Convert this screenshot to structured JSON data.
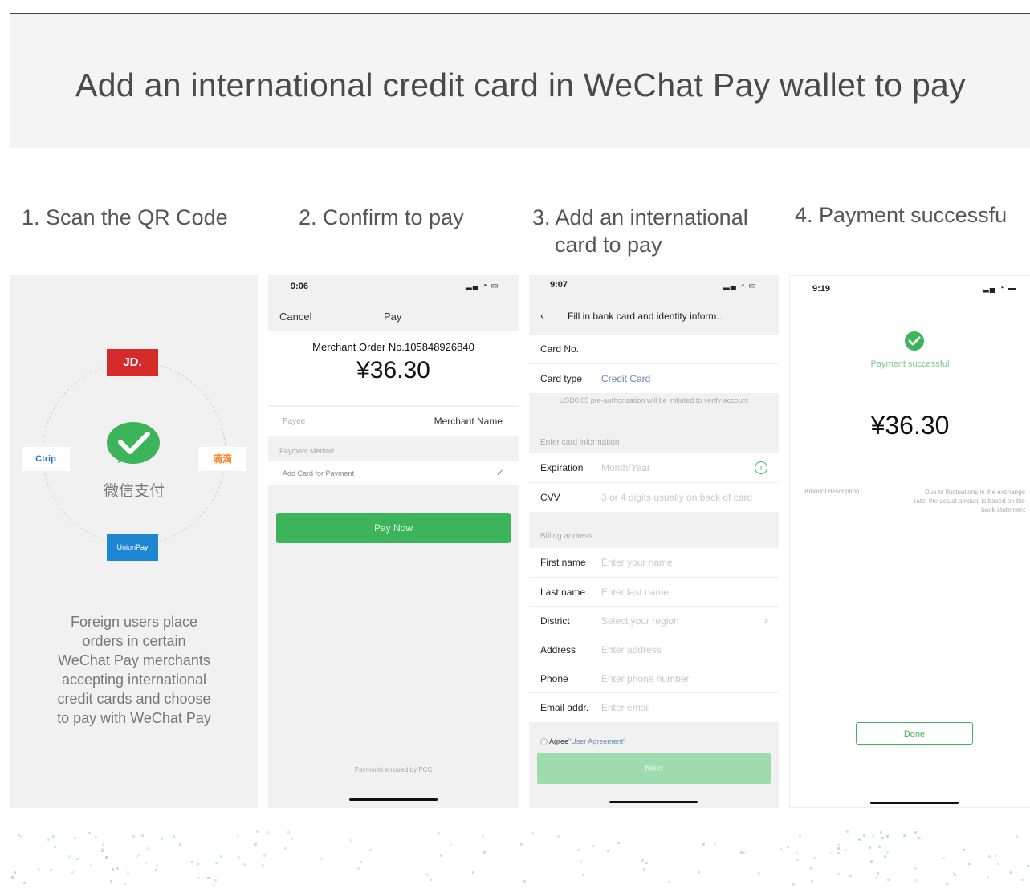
{
  "banner": {
    "title": "Add an international credit card in WeChat Pay wallet to pay"
  },
  "steps": [
    {
      "title": "1. Scan the QR Code"
    },
    {
      "title": "2. Confirm to pay"
    },
    {
      "title_line1": "3. Add an international",
      "title_line2": "card to pay"
    },
    {
      "title": "4. Payment successfu"
    }
  ],
  "step1": {
    "logos": {
      "top": "JD.",
      "left": "Ctrip",
      "right": "滴滴",
      "bottom": "UnionPay"
    },
    "center_label": "微信支付",
    "description": [
      "Foreign users place",
      "orders in certain",
      "WeChat Pay merchants",
      "accepting international",
      "credit cards and choose",
      "to pay with WeChat Pay"
    ]
  },
  "step2": {
    "time": "9:06",
    "cancel": "Cancel",
    "title": "Pay",
    "order": "Merchant Order No.105848926840",
    "amount": "¥36.30",
    "payee_label": "Payee",
    "payee_value": "Merchant Name",
    "method_label": "Payment Method",
    "add_card": "Add Card for Payment",
    "pay_now": "Pay Now",
    "footer": "Payments ensured by PCC"
  },
  "step3": {
    "time": "9:07",
    "header": "Fill in bank card and identity inform...",
    "card_no_label": "Card No.",
    "card_type_label": "Card type",
    "card_type_value": "Credit Card",
    "pre_auth": "USD0.05 pre-authorization will be initiated to verify account",
    "enter_card_info": "Enter card information",
    "expiration_label": "Expiration",
    "expiration_ph": "Month/Year",
    "cvv_label": "CVV",
    "cvv_ph": "3 or 4 digits usually on back of card",
    "billing_address": "Billing address",
    "first_name_label": "First name",
    "first_name_ph": "Enter your name",
    "last_name_label": "Last name",
    "last_name_ph": "Enter last name",
    "district_label": "District",
    "district_ph": "Select your region",
    "address_label": "Address",
    "address_ph": "Enter address",
    "phone_label": "Phone",
    "phone_ph": "Enter phone number",
    "email_label": "Email addr.",
    "email_ph": "Enter email",
    "agree": "Agree",
    "agreement": "\"User Agreement\"",
    "next": "Next"
  },
  "step4": {
    "time": "9:19",
    "success": "Payment successful",
    "amount": "¥36.30",
    "amount_desc_label": "Amount description",
    "amount_desc_value": "Due to fluctuations in the exchange rate, the actual amount is based on the bank statement",
    "done": "Done"
  },
  "colors": {
    "wechat_green": "#3cb45a",
    "jd_red": "#d42a2a",
    "ctrip_blue": "#1b7ad6",
    "didi_orange": "#ff7a1a",
    "unionpay_blue": "#1f86d1"
  }
}
